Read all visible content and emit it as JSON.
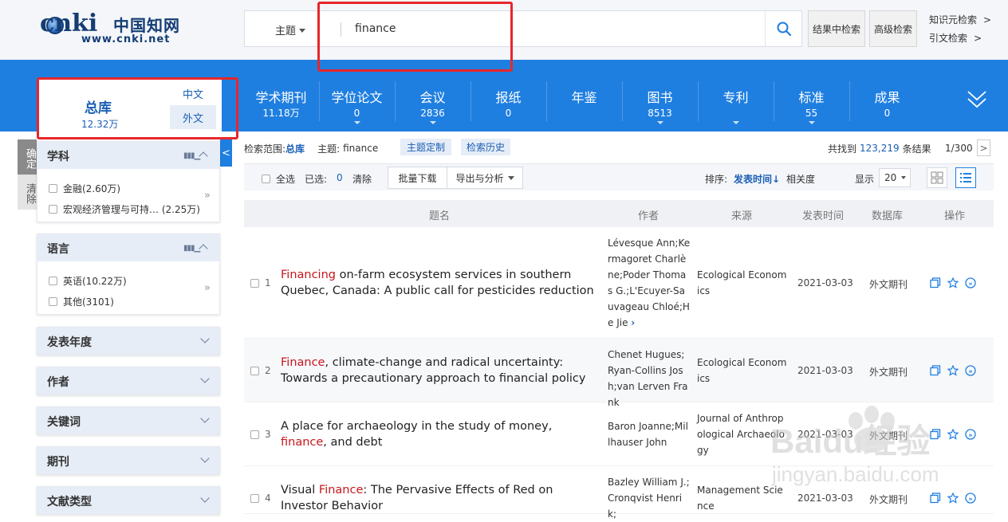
{
  "header": {
    "logo_main": "cnki",
    "logo_cn": "中国知网",
    "logo_url": "www.cnki.net",
    "search_type": "主题",
    "search_value": "finance",
    "result_search": "结果中检索",
    "advanced_search": "高级检索",
    "knowledge_search": "知识元检索",
    "citation_search": "引文检索",
    "arrow": ">"
  },
  "library": {
    "title": "总库",
    "count": "12.32万",
    "chinese": "中文",
    "foreign": "外文"
  },
  "categories": [
    {
      "name": "学术期刊",
      "count": "11.18万",
      "dropdown": false
    },
    {
      "name": "学位论文",
      "count": "0",
      "dropdown": true
    },
    {
      "name": "会议",
      "count": "2836",
      "dropdown": true
    },
    {
      "name": "报纸",
      "count": "0",
      "dropdown": false
    },
    {
      "name": "年鉴",
      "count": "",
      "dropdown": false
    },
    {
      "name": "图书",
      "count": "8513",
      "dropdown": true
    },
    {
      "name": "专利",
      "count": "",
      "dropdown": true
    },
    {
      "name": "标准",
      "count": "55",
      "dropdown": true
    },
    {
      "name": "成果",
      "count": "0",
      "dropdown": false
    }
  ],
  "sidebar": {
    "confirm": "确定",
    "clear": "清除",
    "collapse": "<",
    "subject": {
      "title": "学科",
      "items": [
        "金融(2.60万)",
        "宏观经济管理与可持…   (2.25万)"
      ]
    },
    "language": {
      "title": "语言",
      "items": [
        "英语(10.22万)",
        "其他(3101)"
      ]
    },
    "more": "»",
    "collapsed": [
      "发表年度",
      "作者",
      "关键词",
      "期刊",
      "文献类型"
    ]
  },
  "scope": {
    "label": "检索范围:",
    "value": "总库",
    "topic_label": "主题:",
    "topic_value": "finance",
    "topic_custom": "主题定制",
    "history": "检索历史",
    "found_prefix": "共找到",
    "found_count": "123,219",
    "found_suffix": "条结果",
    "page": "1/300",
    "next": ">"
  },
  "toolbar": {
    "select_all": "全选",
    "selected_label": "已选:",
    "selected_count": "0",
    "clear": "清除",
    "batch_download": "批量下载",
    "export": "导出与分析",
    "sort_label": "排序:",
    "sort_time": "发表时间",
    "sort_relevance": "相关度",
    "display_label": "显示",
    "display_value": "20"
  },
  "table": {
    "headers": [
      "题名",
      "作者",
      "来源",
      "发表时间",
      "数据库",
      "操作"
    ],
    "rows": [
      {
        "num": "1",
        "title_hl": "Financing",
        "title_rest": " on-farm ecosystem services in southern Quebec, Canada: A public call for pesticides reduction",
        "authors": "Lévesque Ann;Kermagoret Charlène;Poder Thomas G.;L'Ecuyer-Sauvageau Chloé;He Jie",
        "author_more": "›",
        "source": "Ecological Economics",
        "date": "2021-03-03",
        "db": "外文期刊"
      },
      {
        "num": "2",
        "title_hl": "Finance",
        "title_rest": ", climate-change and radical uncertainty: Towards a precautionary approach to financial policy",
        "authors": "Chenet Hugues;Ryan-Collins Josh;van Lerven Frank",
        "author_more": "",
        "source": "Ecological Economics",
        "date": "2021-03-03",
        "db": "外文期刊"
      },
      {
        "num": "3",
        "title_pre": "A place for archaeology in the study of money, ",
        "title_hl": "finance",
        "title_rest": ", and debt",
        "authors": "Baron Joanne;Millhauser John",
        "author_more": "",
        "source": "Journal of Anthropological Archaeology",
        "date": "2021-03-03",
        "db": "外文期刊"
      },
      {
        "num": "4",
        "title_pre": "Visual ",
        "title_hl": "Finance",
        "title_rest": ": The Pervasive Effects of Red on Investor Behavior",
        "authors": "Bazley William J.;Cronqvist Henrik;",
        "author_more": "",
        "source": "Management Science",
        "date": "2021-03-03",
        "db": "外文期刊"
      }
    ]
  },
  "watermark": {
    "text": "Baidu经验",
    "url": "jingyan.baidu.com"
  },
  "colors": {
    "brand_blue": "#1f7fe0",
    "highlight_red": "#c8161d",
    "annotation_red": "#e8262b"
  }
}
